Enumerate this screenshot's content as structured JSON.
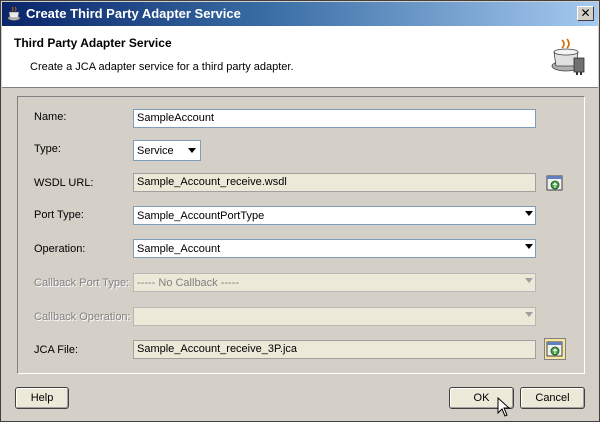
{
  "window": {
    "title": "Create Third Party Adapter Service"
  },
  "header": {
    "title": "Third Party Adapter Service",
    "description": "Create a JCA adapter service for a third party adapter."
  },
  "form": {
    "name": {
      "label": "Name:",
      "value": "SampleAccount"
    },
    "type": {
      "label": "Type:",
      "value": "Service"
    },
    "wsdl_url": {
      "label": "WSDL URL:",
      "value": "Sample_Account_receive.wsdl"
    },
    "port_type": {
      "label": "Port Type:",
      "value": "Sample_AccountPortType"
    },
    "operation": {
      "label": "Operation:",
      "value": "Sample_Account"
    },
    "callback_port_type": {
      "label": "Callback Port Type:",
      "value": "----- No Callback -----"
    },
    "callback_operation": {
      "label": "Callback Operation:",
      "value": ""
    },
    "jca_file": {
      "label": "JCA File:",
      "value": "Sample_Account_receive_3P.jca"
    }
  },
  "buttons": {
    "help": "Help",
    "ok": "OK",
    "cancel": "Cancel"
  },
  "icons": {
    "title": "coffee-cup-icon",
    "header": "adapter-plug-icon",
    "browse_wsdl": "browse-icon",
    "browse_jca": "browse-icon",
    "close": "close-icon"
  },
  "colors": {
    "title_bar_start": "#0a246a",
    "title_bar_end": "#a6caf0",
    "dialog_bg": "#d4d0c8"
  }
}
